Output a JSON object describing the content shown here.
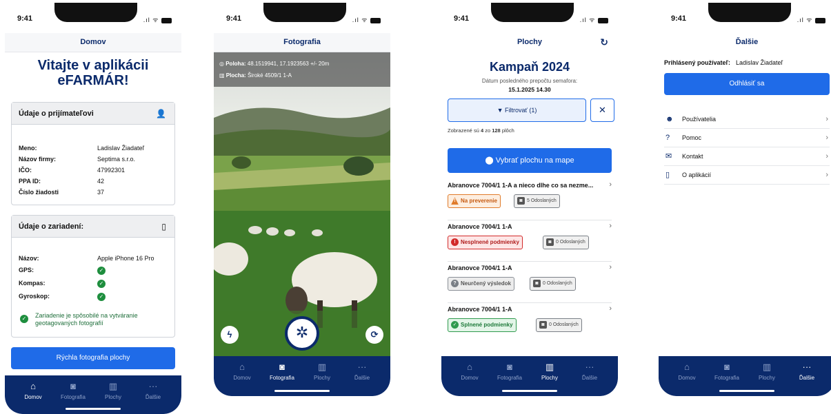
{
  "status": {
    "time": "9:41",
    "signal": ".ıl ᯤ"
  },
  "tabs": [
    {
      "label": "Domov",
      "icon": "home-icon",
      "glyph": "⌂"
    },
    {
      "label": "Fotografia",
      "icon": "camera-icon",
      "glyph": "◙"
    },
    {
      "label": "Plochy",
      "icon": "map-icon",
      "glyph": "▥"
    },
    {
      "label": "Ďalšie",
      "icon": "more-icon",
      "glyph": "···"
    }
  ],
  "home": {
    "nav_title": "Domov",
    "welcome": "Vitajte v aplikácii eFARMÁR!",
    "recipient_card": {
      "title": "Údaje o prijímateľovi",
      "rows": [
        {
          "k": "Meno:",
          "v": "Ladislav Žiadateľ"
        },
        {
          "k": "Názov firmy:",
          "v": "Septima s.r.o."
        },
        {
          "k": "IČO:",
          "v": "47992301"
        },
        {
          "k": "PPA ID:",
          "v": "42"
        },
        {
          "k": "Číslo žiadosti",
          "v": "37"
        }
      ]
    },
    "device_card": {
      "title": "Údaje o zariadení:",
      "name_label": "Názov:",
      "name_value": "Apple iPhone 16 Pro",
      "gps_label": "GPS:",
      "compass_label": "Kompas:",
      "gyro_label": "Gyroskop:",
      "capable": "Zariadenie je spôsobilé na vytváranie geotagovaných fotografií"
    },
    "quick_button": "Rýchla fotografia plochy"
  },
  "photo": {
    "nav_title": "Fotografia",
    "position_label": "Poloha:",
    "position_value": "48.1519941, 17.1923563 +/- 20m",
    "plot_label": "Plocha:",
    "plot_value": "Široké 4509/1 1-A"
  },
  "plots": {
    "nav_title": "Plochy",
    "campaign": "Kampaň 2024",
    "recalc_label": "Dátum posledného prepočtu semafora:",
    "recalc_date": "15.1.2025 14.30",
    "filter_label": "Filtrovať (1)",
    "shown_prefix": "Zobrazené sú ",
    "shown_count": "4",
    "shown_mid": " zo ",
    "shown_total": "128",
    "shown_suffix": " plôch",
    "map_button": "Vybrať plochu na mape",
    "items": [
      {
        "name": "Abranovce 7004/1 1-A a nieco dlhe co sa nezme...",
        "status": "Na preverenie",
        "sent": "5 Odoslaných"
      },
      {
        "name": "Abranovce 7004/1 1-A",
        "status": "Nesplnené podmienky",
        "sent": "0 Odoslaných"
      },
      {
        "name": "Abranovce 7004/1 1-A",
        "status": "Neurčený výsledok",
        "sent": "0 Odoslaných"
      },
      {
        "name": "Abranovce 7004/1 1-A",
        "status": "Splnené podmienky",
        "sent": "0 Odoslaných"
      }
    ],
    "colors": {
      "review": "#e07b2a",
      "failed": "#d22a2a",
      "unknown": "#7a7f86",
      "ok": "#2f9a4e"
    }
  },
  "more": {
    "nav_title": "Ďalšie",
    "user_label": "Prihlásený používateľ:",
    "user_name": "Ladislav Žiadateľ",
    "logout": "Odhlásiť sa",
    "menu": [
      {
        "label": "Používatelia",
        "icon": "users-icon",
        "glyph": "☻"
      },
      {
        "label": "Pomoc",
        "icon": "help-icon",
        "glyph": "?"
      },
      {
        "label": "Kontakt",
        "icon": "mail-icon",
        "glyph": "✉"
      },
      {
        "label": "O aplikácií",
        "icon": "info-icon",
        "glyph": "▯"
      }
    ]
  },
  "colors": {
    "primary": "#1f6be8",
    "navy": "#0b2a6b",
    "success": "#1e8e3e"
  }
}
